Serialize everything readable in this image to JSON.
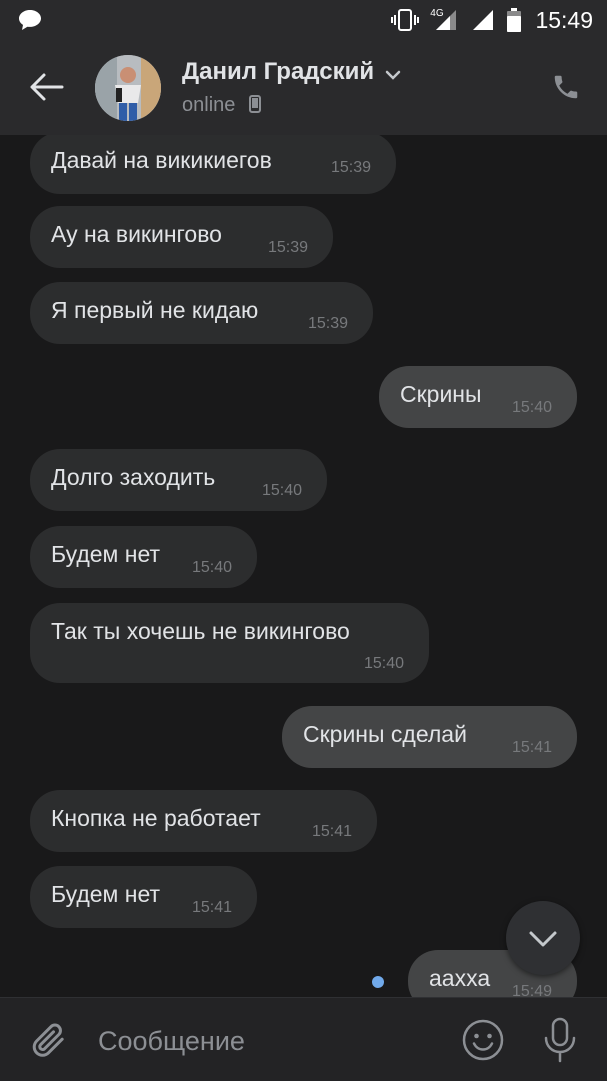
{
  "status_bar": {
    "time": "15:49",
    "network": "4G",
    "icons": [
      "chat-notification-icon",
      "vibrate-icon",
      "signal-4g-icon",
      "signal-icon",
      "battery-icon"
    ]
  },
  "header": {
    "contact_name": "Данил Градский",
    "status": "online",
    "icons": [
      "back-arrow-icon",
      "chevron-down-icon",
      "mobile-device-icon",
      "phone-icon"
    ]
  },
  "messages": [
    {
      "text": "Давай на викикиегов",
      "time": "15:39",
      "direction": "in"
    },
    {
      "text": "Ау на викингово",
      "time": "15:39",
      "direction": "in"
    },
    {
      "text": "Я первый не кидаю",
      "time": "15:39",
      "direction": "in"
    },
    {
      "text": "Скрины",
      "time": "15:40",
      "direction": "out"
    },
    {
      "text": "Долго заходить",
      "time": "15:40",
      "direction": "in"
    },
    {
      "text": "Будем нет",
      "time": "15:40",
      "direction": "in"
    },
    {
      "text": "Так ты хочешь не викингово",
      "time": "15:40",
      "direction": "in"
    },
    {
      "text": "Скрины сделай",
      "time": "15:41",
      "direction": "out"
    },
    {
      "text": "Кнопка не работает",
      "time": "15:41",
      "direction": "in"
    },
    {
      "text": "Будем нет",
      "time": "15:41",
      "direction": "in"
    },
    {
      "text": "аахха",
      "time": "15:49",
      "direction": "out",
      "unread": true
    }
  ],
  "composer": {
    "placeholder": "Сообщение",
    "icons": [
      "paperclip-icon",
      "emoji-icon",
      "microphone-icon"
    ]
  },
  "colors": {
    "background": "#19191a",
    "header": "#2a2a2c",
    "incoming_bubble": "#2c2d2e",
    "outgoing_bubble": "#444546",
    "unread_dot": "#71aaeb"
  }
}
